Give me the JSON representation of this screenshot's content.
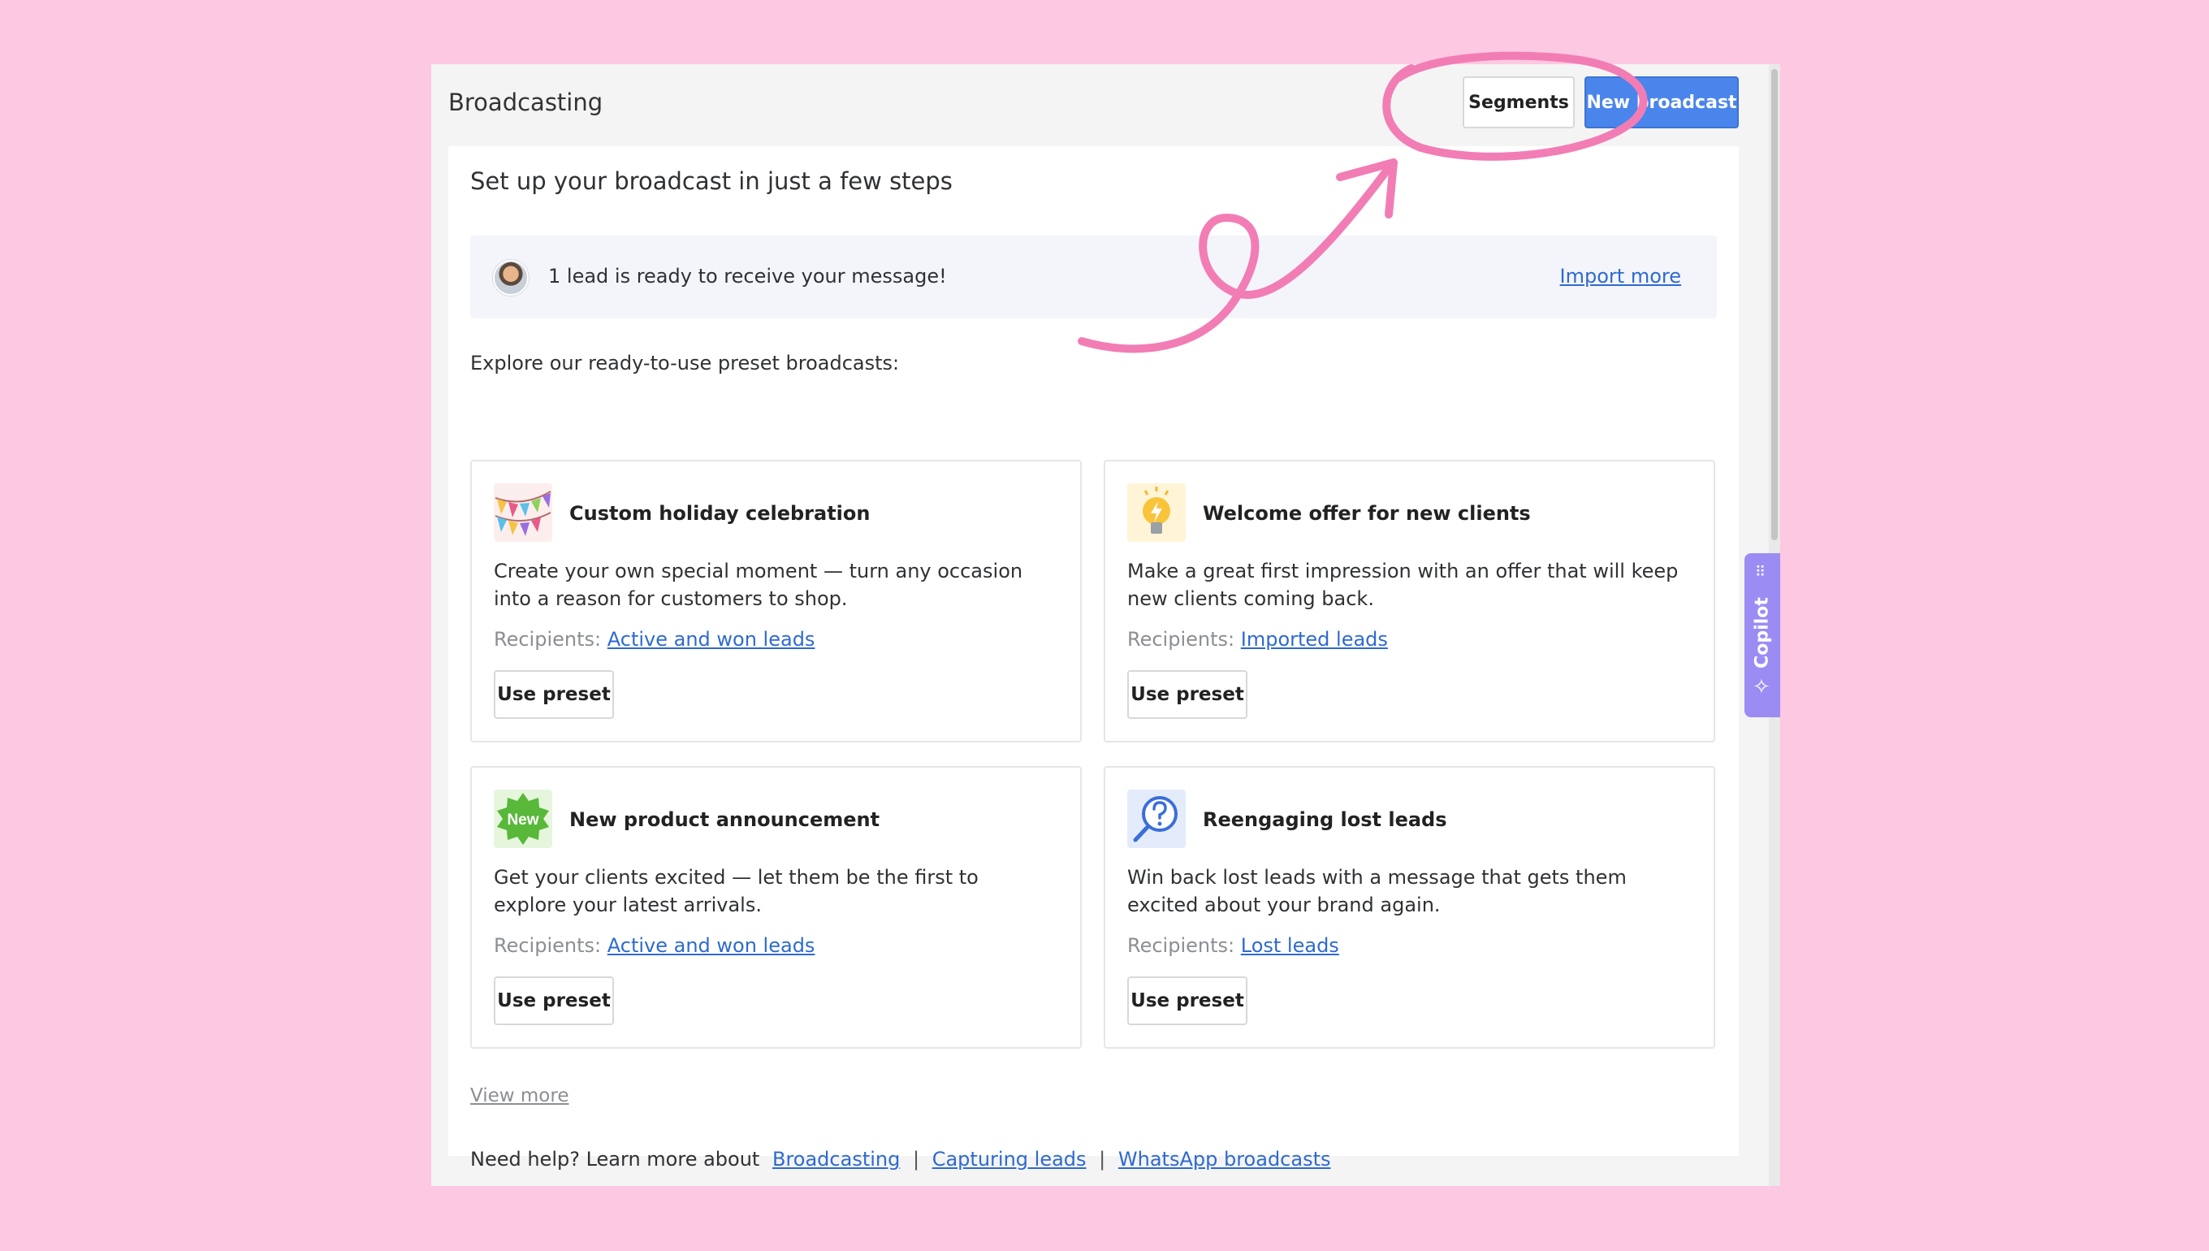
{
  "header": {
    "title": "Broadcasting",
    "segments_label": "Segments",
    "new_broadcast_label": "New broadcast"
  },
  "setup": {
    "title": "Set up your broadcast in just a few steps",
    "lead_message": "1 lead is ready to receive your message!",
    "import_more": "Import more",
    "explore_label": "Explore our ready-to-use preset broadcasts:"
  },
  "presets": [
    {
      "icon": "bunting-flags-icon",
      "title": "Custom holiday celebration",
      "description": "Create your own special moment — turn any occasion into a reason for customers to shop.",
      "recipients_label": "Recipients:",
      "recipients": "Active and won leads",
      "button": "Use preset"
    },
    {
      "icon": "lightbulb-icon",
      "title": "Welcome offer for new clients",
      "description": "Make a great first impression with an offer that will keep new clients coming back.",
      "recipients_label": "Recipients:",
      "recipients": "Imported leads",
      "button": "Use preset"
    },
    {
      "icon": "new-badge-icon",
      "title": "New product announcement",
      "description": "Get your clients excited — let them be the first to explore your latest arrivals.",
      "recipients_label": "Recipients:",
      "recipients": "Active and won leads",
      "button": "Use preset",
      "badge_text": "New"
    },
    {
      "icon": "magnifier-question-icon",
      "title": "Reengaging lost leads",
      "description": "Win back lost leads with a message that gets them excited about your brand again.",
      "recipients_label": "Recipients:",
      "recipients": "Lost leads",
      "button": "Use preset"
    }
  ],
  "footer": {
    "view_more": "View more",
    "help_prefix": "Need help? Learn more about",
    "links": [
      "Broadcasting",
      "Capturing leads",
      "WhatsApp broadcasts"
    ],
    "separator": "|"
  },
  "copilot": {
    "label": "Copilot",
    "icon": "sparkle-icon"
  },
  "colors": {
    "background": "#fdc8e1",
    "accent": "#4a85ec",
    "link": "#2e6ad0",
    "annotation": "#f27db5",
    "copilot": "#9b8cf4"
  }
}
